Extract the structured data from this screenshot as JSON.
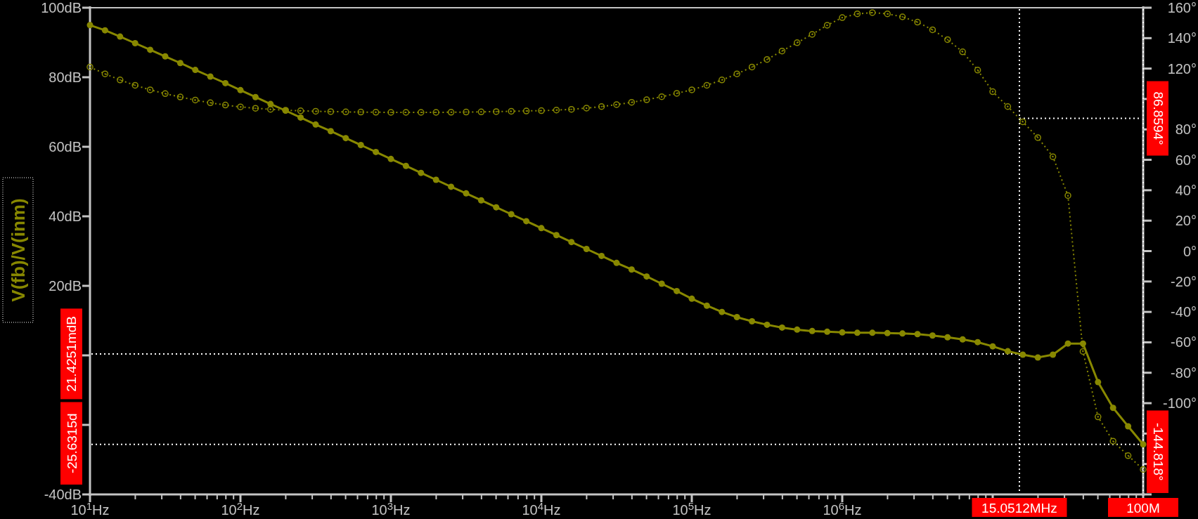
{
  "plot": {
    "chart_data": {
      "type": "line",
      "ylabel": "V(fb)/V(inm)",
      "ylim": [
        -40,
        100
      ],
      "y2lim": [
        -160,
        160
      ],
      "categories": [
        "10$^{1}$Hz",
        null,
        null,
        null,
        null,
        null,
        null,
        null,
        null,
        null,
        "10$^{2}$Hz",
        null,
        null,
        null,
        null,
        null,
        null,
        null,
        null,
        null,
        "10$^{3}$Hz",
        null,
        null,
        null,
        null,
        null,
        null,
        null,
        null,
        null,
        "10$^{4}$Hz",
        null,
        null,
        null,
        null,
        null,
        null,
        null,
        null,
        null,
        "10$^{5}$Hz",
        null,
        null,
        null,
        null,
        null,
        null,
        null,
        null,
        null,
        "10$^{6}$Hz",
        null,
        null,
        null,
        null,
        null,
        null,
        null,
        null,
        null,
        null,
        null,
        null,
        null,
        null,
        null,
        null,
        null,
        null,
        null,
        null
      ],
      "yticks": [
        {
          "value": 100,
          "label": "100dB"
        },
        {
          "value": 80,
          "label": "80dB"
        },
        {
          "value": 60,
          "label": "60dB"
        },
        {
          "value": 40,
          "label": "40dB"
        },
        {
          "value": 20,
          "label": "20dB"
        },
        {
          "value": -40,
          "label": "-40dB"
        }
      ],
      "y2ticks": [
        {
          "value": 160,
          "label": "160°"
        },
        {
          "value": 140,
          "label": "140°"
        },
        {
          "value": 120,
          "label": "120°"
        },
        {
          "value": 80,
          "label": "80°"
        },
        {
          "value": 60,
          "label": "60°"
        },
        {
          "value": 40,
          "label": "40°"
        },
        {
          "value": 20,
          "label": "20°"
        },
        {
          "value": 0,
          "label": "0°"
        },
        {
          "value": -20,
          "label": "-20°"
        },
        {
          "value": -40,
          "label": "-40°"
        },
        {
          "value": -60,
          "label": "-60°"
        },
        {
          "value": -80,
          "label": "-80°"
        },
        {
          "value": -100,
          "label": "-100°"
        }
      ],
      "series": [
        {
          "marker": "circle",
          "values": [
            95,
            93.5,
            91.7,
            89.8,
            87.9,
            86,
            84.1,
            82.1,
            80.2,
            78.3,
            76.3,
            74.3,
            72.3,
            70.4,
            68.4,
            66.4,
            64.5,
            62.5,
            60.5,
            58.5,
            56.5,
            54.5,
            52.5,
            50.5,
            48.5,
            46.6,
            44.6,
            42.6,
            40.6,
            38.6,
            36.6,
            34.6,
            32.6,
            30.6,
            28.6,
            26.6,
            24.7,
            22.7,
            20.6,
            18.5,
            16.3,
            14.3,
            12.5,
            11,
            9.8,
            8.8,
            8,
            7.4,
            7,
            6.8,
            6.6,
            6.5,
            6.5,
            6.4,
            6.3,
            6.1,
            5.7,
            5.2,
            4.6,
            3.8,
            2.6,
            1.2,
            0.2,
            -0.6,
            0.2,
            3.4,
            3.4,
            -7.7,
            -15.1,
            -20.4,
            -25.6
          ]
        },
        {
          "axis": "y2",
          "line_style": "dotted",
          "marker": "circle",
          "values": [
            121,
            116.5,
            112.5,
            109,
            106,
            103.5,
            101.3,
            99.3,
            97.5,
            96,
            94.8,
            93.9,
            93.2,
            92.6,
            92.2,
            91.9,
            91.7,
            91.5,
            91.4,
            91.3,
            91.2,
            91.2,
            91.2,
            91.2,
            91.3,
            91.4,
            91.5,
            91.7,
            91.9,
            92.1,
            92.3,
            92.7,
            93.2,
            94,
            95,
            96.3,
            97.8,
            99.5,
            101.5,
            103.7,
            106,
            109,
            112.5,
            116.5,
            121,
            126,
            131.5,
            137,
            142.5,
            148.5,
            153.5,
            156,
            156.8,
            156,
            154,
            150.5,
            145.5,
            139,
            131,
            119,
            104.8,
            95,
            85,
            74.6,
            62,
            36.5,
            -66,
            -109,
            -125,
            -134.5,
            -143.6
          ]
        }
      ],
      "annotations": [
        "15.0512MHz",
        "21.4251mdB",
        "86.8594°",
        "100M",
        "-25.6315d",
        "-144.818°"
      ]
    }
  }
}
